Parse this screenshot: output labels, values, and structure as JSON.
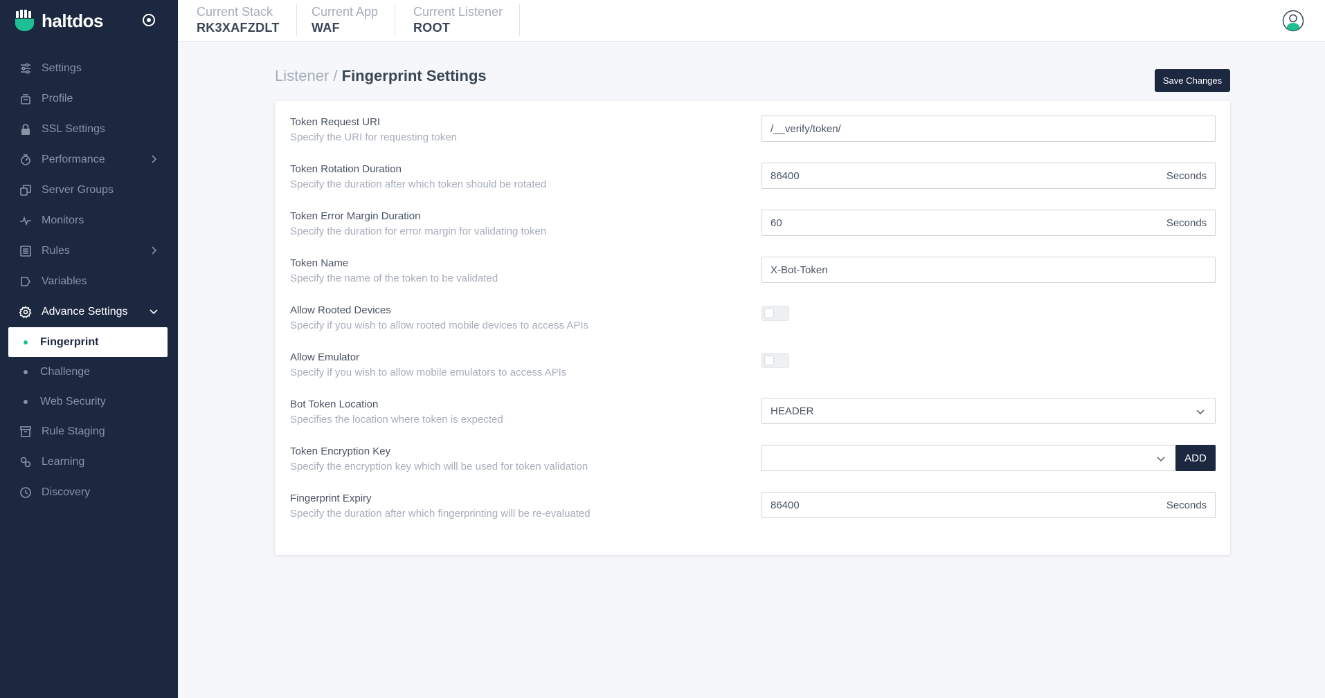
{
  "brand": {
    "name": "haltdos"
  },
  "header": {
    "blocks": [
      {
        "label": "Current Stack",
        "value": "RK3XAFZDLT"
      },
      {
        "label": "Current App",
        "value": "WAF"
      },
      {
        "label": "Current Listener",
        "value": "ROOT"
      }
    ]
  },
  "sidebar": {
    "items": [
      {
        "label": "Settings",
        "icon": "sliders-icon"
      },
      {
        "label": "Profile",
        "icon": "profile-icon"
      },
      {
        "label": "SSL Settings",
        "icon": "lock-icon"
      },
      {
        "label": "Performance",
        "icon": "performance-icon"
      },
      {
        "label": "Server Groups",
        "icon": "server-groups-icon"
      },
      {
        "label": "Monitors",
        "icon": "pulse-icon"
      },
      {
        "label": "Rules",
        "icon": "rules-icon"
      },
      {
        "label": "Variables",
        "icon": "variables-icon"
      },
      {
        "label": "Advance Settings",
        "icon": "gear-icon"
      }
    ],
    "sub_items": [
      {
        "label": "Fingerprint",
        "active": true
      },
      {
        "label": "Challenge"
      },
      {
        "label": "Web Security"
      }
    ],
    "bottom_items": [
      {
        "label": "Rule Staging",
        "icon": "archive-icon"
      },
      {
        "label": "Learning",
        "icon": "learning-icon"
      },
      {
        "label": "Discovery",
        "icon": "history-icon"
      }
    ]
  },
  "page": {
    "breadcrumb_parent": "Listener /",
    "title": "Fingerprint Settings",
    "save_label": "Save Changes"
  },
  "form": {
    "rows": [
      {
        "label": "Token Request URI",
        "desc": "Specify the URI for requesting token",
        "value": "/__verify/token/"
      },
      {
        "label": "Token Rotation Duration",
        "desc": "Specify the duration after which token should be rotated",
        "value": "86400",
        "unit": "Seconds"
      },
      {
        "label": "Token Error Margin Duration",
        "desc": "Specify the duration for error margin for validating token",
        "value": "60",
        "unit": "Seconds"
      },
      {
        "label": "Token Name",
        "desc": "Specify the name of the token to be validated",
        "value": "X-Bot-Token"
      },
      {
        "label": "Allow Rooted Devices",
        "desc": "Specify if you wish to allow rooted mobile devices to access APIs",
        "enabled": false
      },
      {
        "label": "Allow Emulator",
        "desc": "Specify if you wish to allow mobile emulators to access APIs",
        "enabled": false
      },
      {
        "label": "Bot Token Location",
        "desc": "Specifies the location where token is expected",
        "value": "HEADER"
      },
      {
        "label": "Token Encryption Key",
        "desc": "Specify the encryption key which will be used for token validation",
        "value": "",
        "button": "ADD"
      },
      {
        "label": "Fingerprint Expiry",
        "desc": "Specify the duration after which fingerprinting will be re-evaluated",
        "value": "86400",
        "unit": "Seconds"
      }
    ]
  },
  "colors": {
    "sidebar": "#1c2740",
    "accent": "#1fbf96",
    "primary_button": "#1c2740"
  }
}
